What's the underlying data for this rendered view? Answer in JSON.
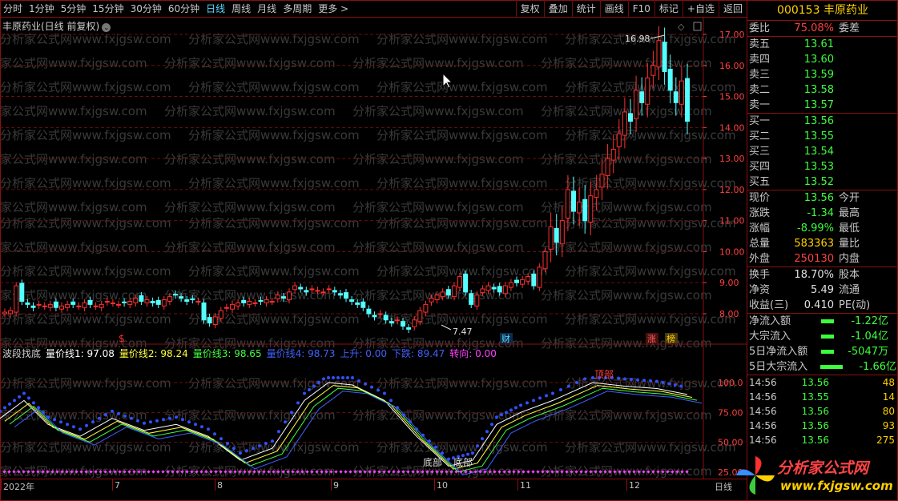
{
  "toolbar": {
    "tabs": [
      "分时",
      "1分钟",
      "5分钟",
      "15分钟",
      "30分钟",
      "60分钟",
      "日线",
      "周线",
      "月线",
      "多周期",
      "更多 >"
    ],
    "active": "日线",
    "right": [
      "复权",
      "叠加",
      "统计",
      "画线",
      "F10",
      "标记",
      "+自选",
      "返回"
    ]
  },
  "chart": {
    "title": "丰原药业(日线 前复权)",
    "high_label": "16.98",
    "low_label": "7.47",
    "y_ticks": [
      "17.00",
      "16.00",
      "15.00",
      "14.00",
      "13.00",
      "12.00",
      "11.00",
      "10.00",
      "9.00",
      "8.00"
    ],
    "markers": {
      "dollar": "$",
      "cai": "财",
      "zhang": "涨",
      "bang": "榜"
    },
    "watermark": "分析家公式网www.fxjgsw.com"
  },
  "indicator": {
    "name": "波段找底",
    "items": [
      {
        "label": "量价线1: 97.08",
        "color": "#ffffff"
      },
      {
        "label": "量价线2: 98.24",
        "color": "#ffff40"
      },
      {
        "label": "量价线3: 98.65",
        "color": "#40ff40"
      },
      {
        "label": "量价线4: 98.73",
        "color": "#4060ff"
      },
      {
        "label": "上升: 0.00",
        "color": "#4060ff"
      },
      {
        "label": "下跌: 89.47",
        "color": "#4060ff"
      },
      {
        "label": "转向: 0.00",
        "color": "#ff40ff"
      }
    ],
    "y_ticks": [
      "100.0",
      "75.00",
      "50.00",
      "25.00"
    ],
    "labels": {
      "bottom1": "底部",
      "bottom2": "底部",
      "top": "顶部"
    }
  },
  "xaxis": {
    "labels": [
      "2022年",
      "7",
      "8",
      "9",
      "10",
      "11",
      "12"
    ],
    "corner": "日线"
  },
  "quote": {
    "code": "000153",
    "name": "丰原药业",
    "weibi_label": "委比",
    "weibi": "75.08%",
    "weicha_label": "委差",
    "sell": [
      {
        "k": "卖五",
        "v": "13.61"
      },
      {
        "k": "卖四",
        "v": "13.60"
      },
      {
        "k": "卖三",
        "v": "13.59"
      },
      {
        "k": "卖二",
        "v": "13.58"
      },
      {
        "k": "卖一",
        "v": "13.57"
      }
    ],
    "buy": [
      {
        "k": "买一",
        "v": "13.56"
      },
      {
        "k": "买二",
        "v": "13.55"
      },
      {
        "k": "买三",
        "v": "13.54"
      },
      {
        "k": "买四",
        "v": "13.53"
      },
      {
        "k": "买五",
        "v": "13.52"
      }
    ],
    "stats": [
      {
        "k": "现价",
        "v": "13.56",
        "c": "green",
        "k2": "今开"
      },
      {
        "k": "涨跌",
        "v": "-1.34",
        "c": "green",
        "k2": "最高"
      },
      {
        "k": "涨幅",
        "v": "-8.99%",
        "c": "green",
        "k2": "最低"
      },
      {
        "k": "总量",
        "v": "583363",
        "c": "yellow",
        "k2": "量比"
      },
      {
        "k": "外盘",
        "v": "250130",
        "c": "red",
        "k2": "内盘"
      }
    ],
    "stats2": [
      {
        "k": "换手",
        "v": "18.70%",
        "c": "white",
        "k2": "股本"
      },
      {
        "k": "净资",
        "v": "5.49",
        "c": "white",
        "k2": "流通"
      },
      {
        "k": "收益(三)",
        "v": "0.410",
        "c": "white",
        "k2": "PE(动)"
      }
    ],
    "flows": [
      {
        "k": "净流入额",
        "v": "-1.22亿"
      },
      {
        "k": "大宗流入",
        "v": "-1.04亿"
      },
      {
        "k": "5日净流入额",
        "v": "-5047万"
      },
      {
        "k": "5日大宗流入",
        "v": "-1.66亿"
      }
    ],
    "ticks": [
      {
        "t": "14:56",
        "p": "13.56",
        "q": "48"
      },
      {
        "t": "14:56",
        "p": "13.55",
        "q": "14"
      },
      {
        "t": "14:56",
        "p": "13.56",
        "q": "80"
      },
      {
        "t": "14:56",
        "p": "13.56",
        "q": "93"
      },
      {
        "t": "14:56",
        "p": "13.56",
        "q": "275"
      }
    ]
  },
  "logo": {
    "brand": "分析家公式网",
    "url": "www.fxjgsw.com"
  },
  "colors": {
    "up": "#ff3030",
    "down": "#54ffff",
    "grid": "#6b0e0e"
  }
}
